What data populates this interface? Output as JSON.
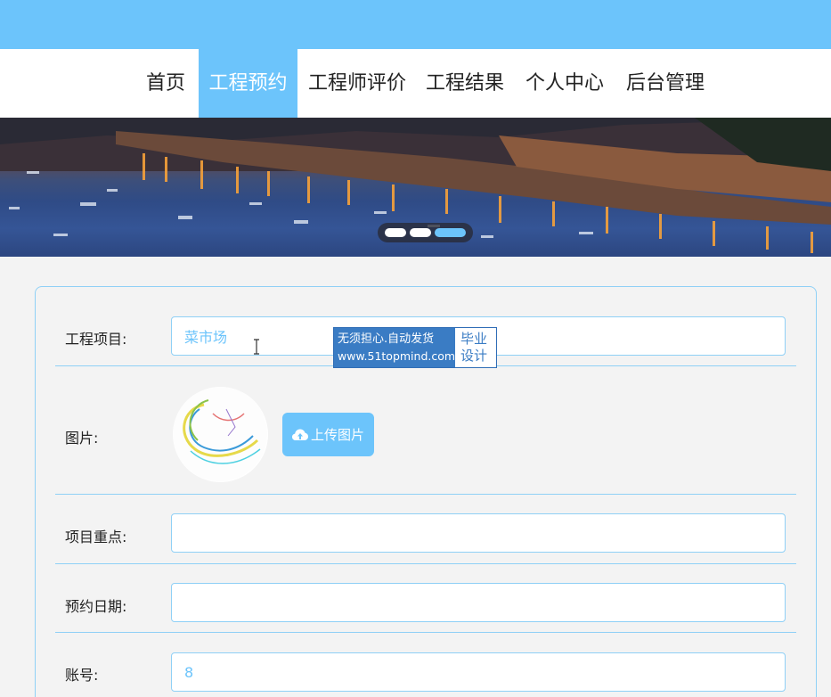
{
  "nav": {
    "items": [
      "首页",
      "工程预约",
      "工程师评价",
      "工程结果",
      "个人中心",
      "后台管理"
    ],
    "active_index": 1
  },
  "carousel": {
    "slides": 3,
    "active_index": 2
  },
  "form": {
    "project": {
      "label": "工程项目:",
      "value": "菜市场"
    },
    "image": {
      "label": "图片:",
      "upload_label": "上传图片"
    },
    "focus": {
      "label": "项目重点:",
      "value": ""
    },
    "date": {
      "label": "预约日期:",
      "value": ""
    },
    "account": {
      "label": "账号:",
      "value": "8"
    }
  },
  "watermark": {
    "line1": "无须担心.自动发货",
    "line2": "www.51topmind.com",
    "badge_line1": "毕业",
    "badge_line2": "设计"
  },
  "colors": {
    "accent": "#6cc4fb",
    "border": "#8fd0f6",
    "background": "#f3f3f3"
  },
  "icons": [
    "cloud-upload-icon",
    "text-cursor-icon"
  ]
}
